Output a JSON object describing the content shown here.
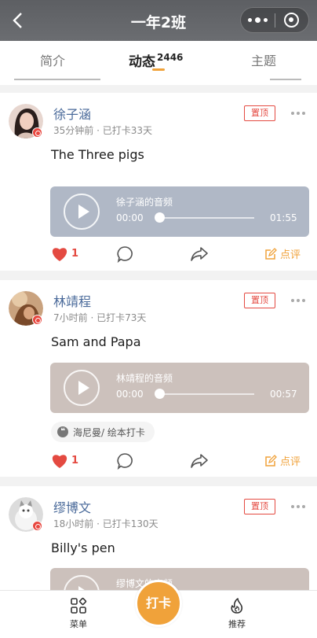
{
  "header": {
    "title": "一年2班"
  },
  "tabs": [
    {
      "label": "简介"
    },
    {
      "label": "动态",
      "count": "2446"
    },
    {
      "label": "主题"
    }
  ],
  "posts": [
    {
      "name": "徐子涵",
      "meta": "35分钟前 · 已打卡33天",
      "pin": "置顶",
      "text": "The Three pigs",
      "audio": {
        "title": "徐子涵的音频",
        "current": "00:00",
        "total": "01:55",
        "progress": 0
      },
      "likes": "1",
      "review": "点评"
    },
    {
      "name": "林靖程",
      "meta": "7小时前 · 已打卡73天",
      "pin": "置顶",
      "text": "Sam and Papa",
      "audio": {
        "title": "林靖程的音频",
        "current": "00:00",
        "total": "00:57",
        "progress": 0
      },
      "tag": "海尼曼/ 绘本打卡",
      "likes": "1",
      "review": "点评"
    },
    {
      "name": "缪博文",
      "meta": "18小时前 · 已打卡130天",
      "pin": "置顶",
      "text": "Billy's pen",
      "audio": {
        "title": "缪博文的音频"
      }
    }
  ],
  "bottom": {
    "menu": "菜单",
    "checkin": "打卡",
    "recommend": "推荐"
  },
  "colors": {
    "accent": "#f0a23a",
    "pin": "#e44a41",
    "name": "#4a6a9a"
  }
}
